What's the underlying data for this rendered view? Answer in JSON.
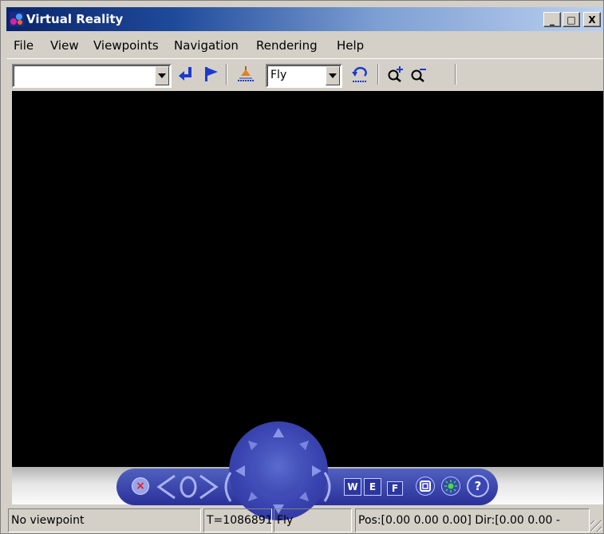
{
  "window": {
    "title": "Virtual Reality",
    "minimize_label": "_",
    "maximize_label": "□",
    "close_label": "X"
  },
  "menu": {
    "items": [
      "File",
      "View",
      "Viewpoints",
      "Navigation",
      "Rendering",
      "Help"
    ]
  },
  "toolbar": {
    "viewpoint_combo_value": "",
    "navigation_mode_value": "Fly",
    "icons": [
      "return-arrow-icon",
      "flag-icon",
      "ground-plane-icon",
      "undo-move-icon",
      "zoom-in-icon",
      "zoom-out-icon"
    ]
  },
  "nav_panel": {
    "close_symbol": "×",
    "wireframe_label": "W",
    "headlight_label": "E",
    "fly_label": "F",
    "help_label": "?",
    "icons": [
      "close-icon",
      "slide-left-icon",
      "rotate-icon",
      "slide-right-icon",
      "navigation-wheel-icon",
      "straighten-icon",
      "light-icon",
      "help-icon"
    ]
  },
  "status": {
    "viewpoint": "No viewpoint",
    "time": "T=10868917",
    "mode": "Fly",
    "position": "Pos:[0.00 0.00 0.00] Dir:[0.00 0.00 -"
  },
  "colors": {
    "titlebar_start": "#0a246a",
    "titlebar_end": "#bcd0ef",
    "viewport_bg": "#000000",
    "nav_panel": "#2a309a",
    "chrome": "#d4d0c8"
  }
}
